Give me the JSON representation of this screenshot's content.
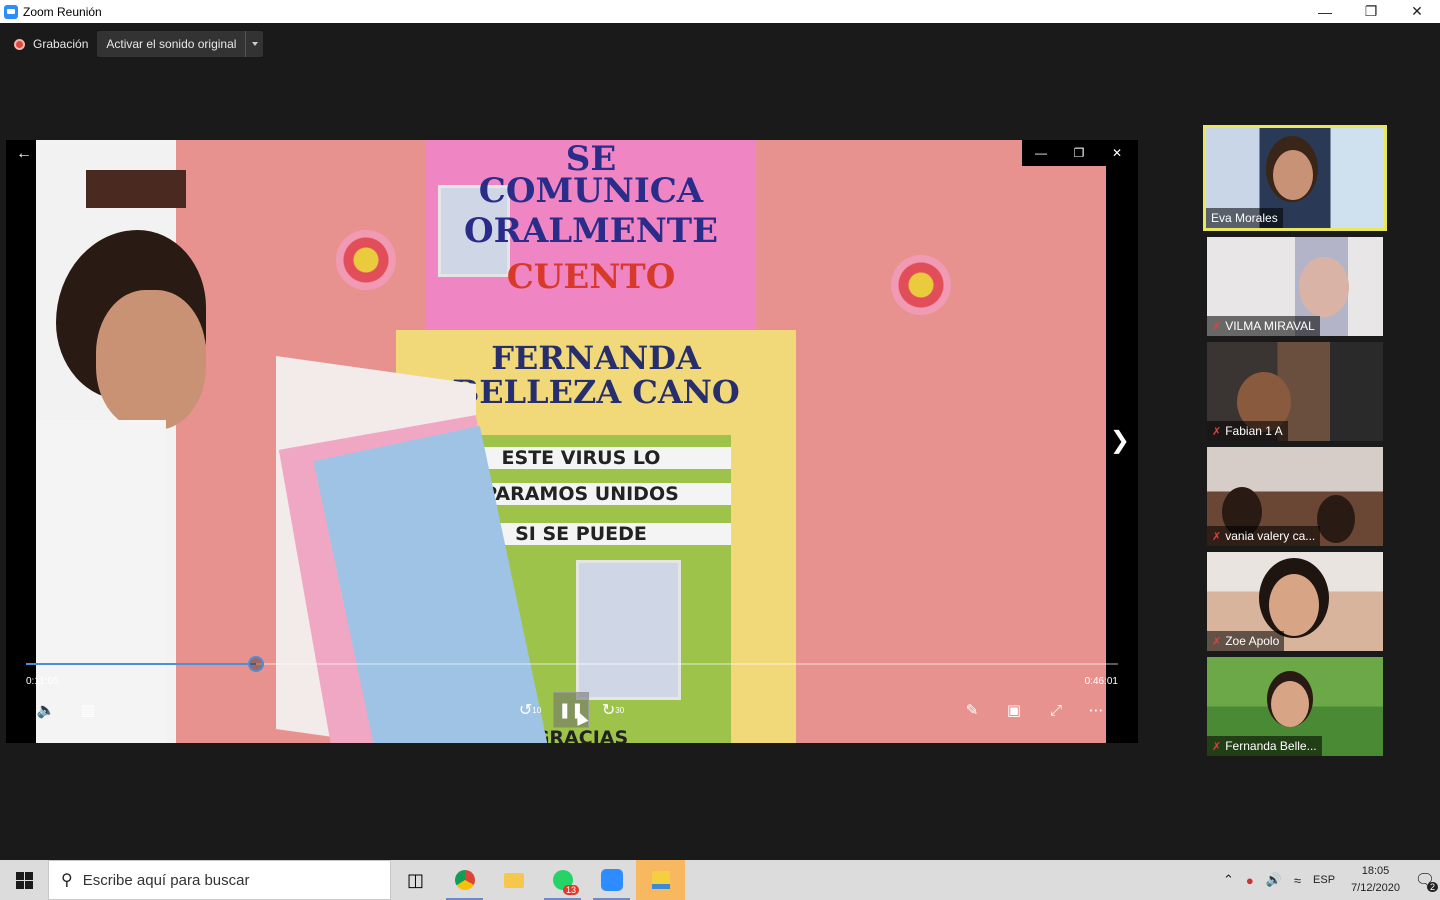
{
  "window": {
    "title": "Zoom Reunión"
  },
  "toolbar": {
    "recording_label": "Grabación",
    "sound_button": "Activar el sonido original"
  },
  "shared_content": {
    "poster_lines": [
      "SE",
      "COMUNICA",
      "ORALMENTE"
    ],
    "poster_sub": "CUENTO",
    "name_lines": [
      "FERNANDA",
      "BELLEZA CANO"
    ],
    "message_lines": [
      "ESTE VIRUS LO",
      "PARAMOS UNIDOS",
      "SI SE PUEDE"
    ],
    "bottom_text": "GRACIAS"
  },
  "player": {
    "current_time": "0:11:05",
    "total_time": "0:46:01",
    "progress": 0.2108,
    "rewind_label": "10",
    "forward_label": "30"
  },
  "participants": [
    {
      "name": "Eva Morales",
      "muted": false,
      "active": true
    },
    {
      "name": "VILMA MIRAVAL",
      "muted": true,
      "active": false
    },
    {
      "name": "Fabian 1 A",
      "muted": true,
      "active": false
    },
    {
      "name": "vania valery ca...",
      "muted": true,
      "active": false
    },
    {
      "name": "Zoe Apolo",
      "muted": true,
      "active": false
    },
    {
      "name": "Fernanda Belle...",
      "muted": true,
      "active": false
    }
  ],
  "taskbar": {
    "search_placeholder": "Escribe aquí para buscar",
    "whatsapp_badge": "13",
    "language": "ESP",
    "time": "18:05",
    "date": "7/12/2020",
    "notifications": "2"
  },
  "colors": {
    "accent": "#2D8CFF",
    "active_speaker": "#e8e85a",
    "seek": "#4a8fd8",
    "recording": "#e0483e"
  }
}
